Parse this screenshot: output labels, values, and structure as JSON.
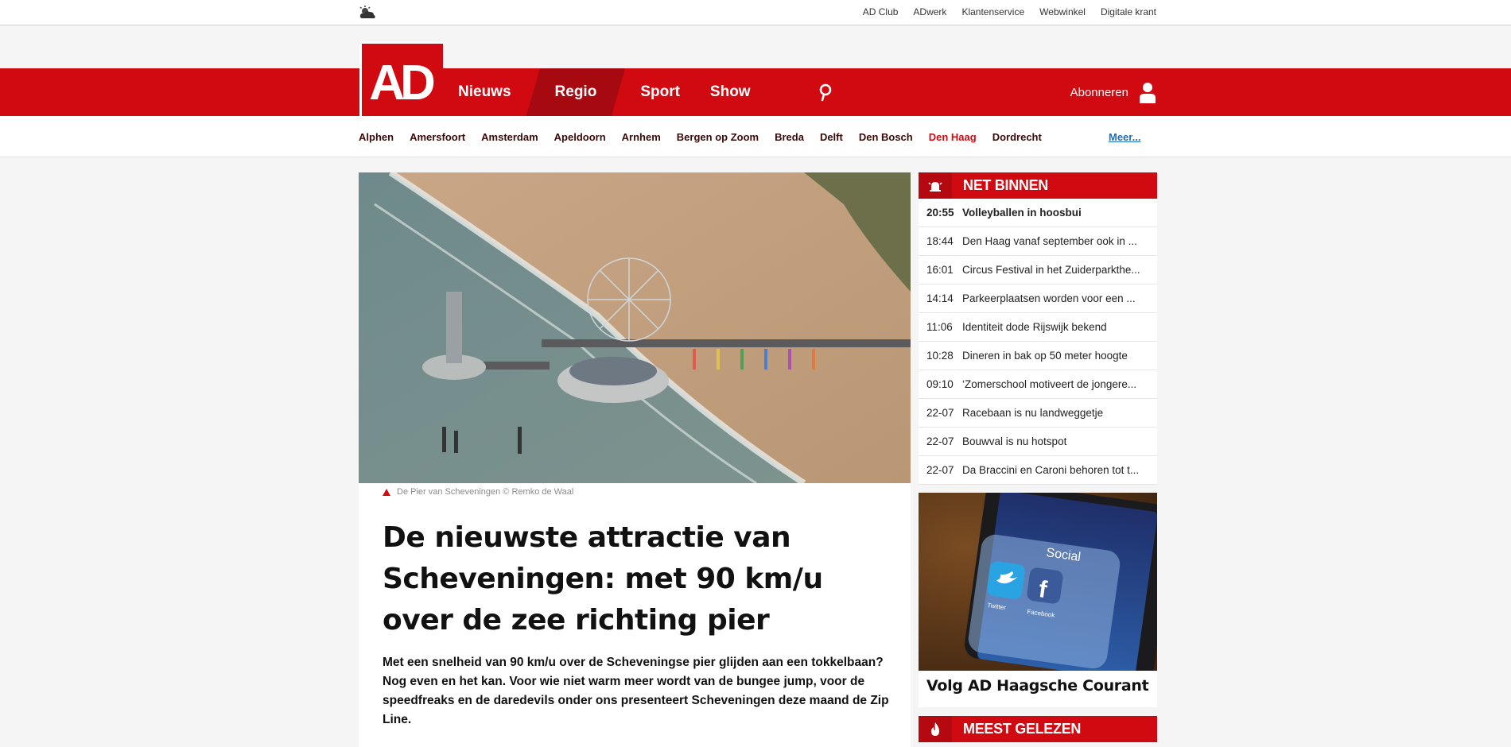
{
  "topbar": {
    "weather_icon": "cloud-sun-icon",
    "links": [
      "AD Club",
      "ADwerk",
      "Klantenservice",
      "Webwinkel",
      "Digitale krant"
    ]
  },
  "header": {
    "logo_text": "AD",
    "nav": [
      "Nieuws",
      "Regio",
      "Sport",
      "Show"
    ],
    "active_nav": "Regio",
    "search_icon": "search-icon",
    "subscribe_label": "Abonneren",
    "user_icon": "user-icon"
  },
  "regions": {
    "items": [
      "Alphen",
      "Amersfoort",
      "Amsterdam",
      "Apeldoorn",
      "Arnhem",
      "Bergen op Zoom",
      "Breda",
      "Delft",
      "Den Bosch",
      "Den Haag",
      "Dordrecht"
    ],
    "active": "Den Haag",
    "more_label": "Meer..."
  },
  "article": {
    "caption": "De Pier van Scheveningen © Remko de Waal",
    "headline": "De nieuwste attractie van Scheveningen: met 90 km/u over de zee richting pier",
    "intro": "Met een snelheid van 90 km/u over de Scheveningse pier glijden aan een tokkelbaan? Nog even en het kan. Voor wie niet warm meer wordt van de bungee jump, voor de speedfreaks en de daredevils onder ons presenteert Scheveningen deze maand de Zip Line."
  },
  "net_binnen": {
    "title": "NET BINNEN",
    "icon": "alarm-bell-icon",
    "items": [
      {
        "time": "20:55",
        "headline": "Volleyballen in hoosbui"
      },
      {
        "time": "18:44",
        "headline": "Den Haag vanaf september ook in ..."
      },
      {
        "time": "16:01",
        "headline": "Circus Festival in het Zuiderparkthe..."
      },
      {
        "time": "14:14",
        "headline": "Parkeerplaatsen worden voor een ..."
      },
      {
        "time": "11:06",
        "headline": "Identiteit dode Rijswijk bekend"
      },
      {
        "time": "10:28",
        "headline": "Dineren in bak op 50 meter hoogte"
      },
      {
        "time": "09:10",
        "headline": "‘Zomerschool motiveert de jongere..."
      },
      {
        "time": "22-07",
        "headline": "Racebaan is nu landweggetje"
      },
      {
        "time": "22-07",
        "headline": "Bouwval is nu hotspot"
      },
      {
        "time": "22-07",
        "headline": "Da Braccini en Caroni behoren tot t..."
      }
    ]
  },
  "social": {
    "title": "Volg AD Haagsche Courant",
    "folder_label": "Social",
    "app_labels": [
      "Twitter",
      "Facebook"
    ]
  },
  "meest_gelezen": {
    "title": "MEEST GELEZEN",
    "icon": "flame-icon"
  },
  "colors": {
    "brand_red": "#d10a11",
    "active_nav": "#a60a10",
    "link_blue": "#1f6fb4"
  }
}
